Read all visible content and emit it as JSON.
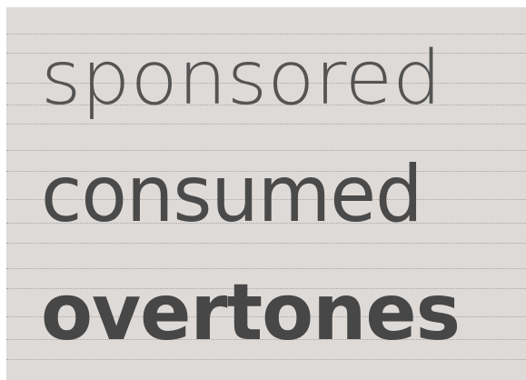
{
  "specimen": {
    "lines": [
      {
        "text": "sponsored",
        "weight": "thin"
      },
      {
        "text": "consumed",
        "weight": "regular"
      },
      {
        "text": "overtones",
        "weight": "bold"
      }
    ]
  },
  "colors": {
    "background": "#dddad8",
    "text": "#4a4a4a",
    "rule": "#a9a6a4"
  }
}
